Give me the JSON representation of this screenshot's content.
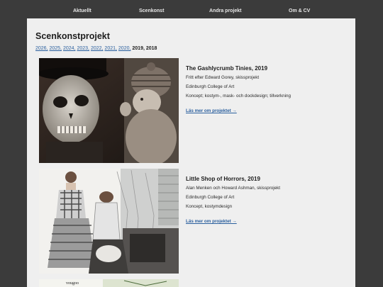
{
  "nav": {
    "items": [
      {
        "label": "Aktuellt"
      },
      {
        "label": "Scenkonst"
      },
      {
        "label": "Andra projekt"
      },
      {
        "label": "Om & CV"
      }
    ]
  },
  "page": {
    "title": "Scenkonstprojekt",
    "years": [
      {
        "label": "2026,",
        "current": false
      },
      {
        "label": "2025,",
        "current": false
      },
      {
        "label": "2024,",
        "current": false
      },
      {
        "label": "2023,",
        "current": false
      },
      {
        "label": "2022,",
        "current": false
      },
      {
        "label": "2021,",
        "current": false
      },
      {
        "label": "2020,",
        "current": false
      },
      {
        "label": "2019,",
        "current": true
      },
      {
        "label": "2018",
        "current": true
      }
    ]
  },
  "projects": [
    {
      "title": "The Gashlycrumb Tinies, 2019",
      "lines": [
        "Fritt efter Edward Gorey, skissprojekt",
        "Edinburgh College of Art",
        "Koncept; kostym-, mask- och dockdesign; tillverkning"
      ],
      "link": "Läs mer om projektet →"
    },
    {
      "title": "Little Shop of Horrors, 2019",
      "lines": [
        "Alan Menken och Howard Ashman, skissprojekt",
        "Edinburgh College of Art",
        "Koncept, kostymdesign"
      ],
      "link": "Läs mer om projektet →"
    }
  ],
  "third_image_caption": "vougoo"
}
